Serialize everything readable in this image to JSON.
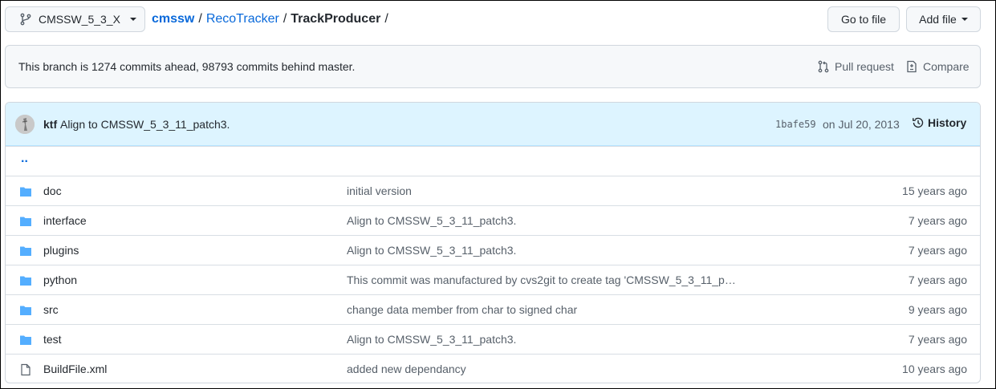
{
  "branch": {
    "name": "CMSSW_5_3_X"
  },
  "breadcrumb": {
    "repo": "cmssw",
    "sep1": "/",
    "dir": "RecoTracker",
    "sep2": "/",
    "current": "TrackProducer",
    "sep3": "/"
  },
  "toolbar": {
    "goto_label": "Go to file",
    "addfile_label": "Add file"
  },
  "branch_info": {
    "text": "This branch is 1274 commits ahead, 98793 commits behind master.",
    "pull_request_label": "Pull request",
    "compare_label": "Compare"
  },
  "latest_commit": {
    "author": "ktf",
    "message": "Align to CMSSW_5_3_11_patch3.",
    "sha": "1bafe59",
    "date": "on Jul 20, 2013",
    "history_label": "History"
  },
  "parent_link": "..",
  "files": [
    {
      "name": "doc",
      "type": "folder",
      "message": "initial version",
      "age": "15 years ago"
    },
    {
      "name": "interface",
      "type": "folder",
      "message": "Align to CMSSW_5_3_11_patch3.",
      "age": "7 years ago"
    },
    {
      "name": "plugins",
      "type": "folder",
      "message": "Align to CMSSW_5_3_11_patch3.",
      "age": "7 years ago"
    },
    {
      "name": "python",
      "type": "folder",
      "message": "This commit was manufactured by cvs2git to create tag 'CMSSW_5_3_11_p…",
      "age": "7 years ago"
    },
    {
      "name": "src",
      "type": "folder",
      "message": "change data member from char to signed char",
      "age": "9 years ago"
    },
    {
      "name": "test",
      "type": "folder",
      "message": "Align to CMSSW_5_3_11_patch3.",
      "age": "7 years ago"
    },
    {
      "name": "BuildFile.xml",
      "type": "file",
      "message": "added new dependancy",
      "age": "10 years ago"
    }
  ],
  "colors": {
    "link": "#0969da",
    "folder": "#54aeff",
    "commit_bar": "#ddf4ff"
  }
}
